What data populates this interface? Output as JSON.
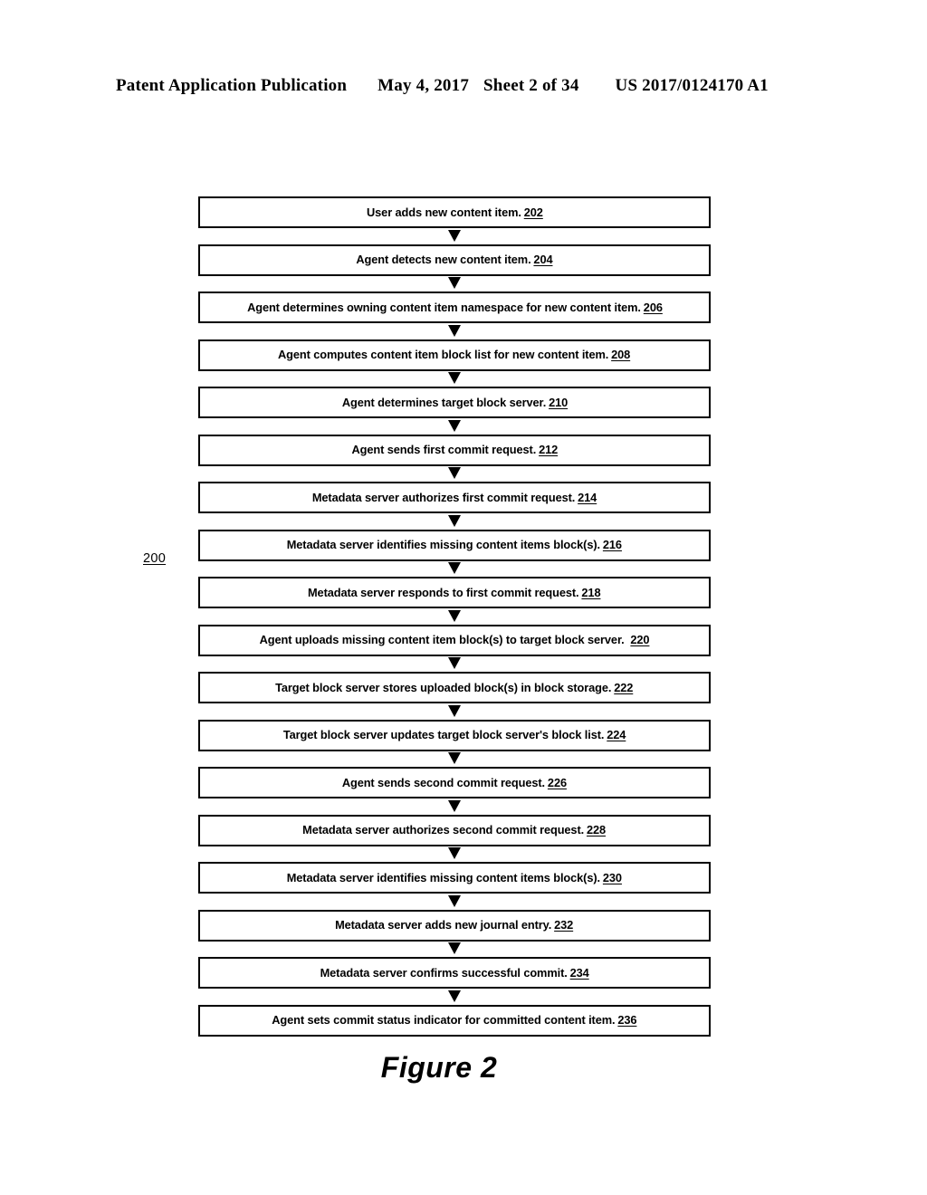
{
  "header": {
    "publication": "Patent Application Publication",
    "date": "May 4, 2017",
    "sheet": "Sheet 2 of 34",
    "document_number": "US 2017/0124170 A1"
  },
  "figure": {
    "caption": "Figure 2",
    "diagram_reference": "200"
  },
  "flowchart": {
    "type": "flowchart",
    "orientation": "top-to-bottom",
    "connector": "solid-down-arrow",
    "steps": [
      {
        "text": "User adds new content item.",
        "ref": "202"
      },
      {
        "text": "Agent detects new content item.",
        "ref": "204"
      },
      {
        "text": "Agent determines owning content item namespace for new content item.",
        "ref": "206"
      },
      {
        "text": "Agent computes content item block list for new content item.",
        "ref": "208"
      },
      {
        "text": "Agent determines target block server.",
        "ref": "210"
      },
      {
        "text": "Agent sends first commit request.",
        "ref": "212"
      },
      {
        "text": "Metadata server authorizes first commit request.",
        "ref": "214"
      },
      {
        "text": "Metadata server identifies missing content items block(s).",
        "ref": "216"
      },
      {
        "text": "Metadata server responds to first commit request.",
        "ref": "218"
      },
      {
        "text": "Agent uploads missing content item block(s) to target block server.",
        "ref": "220",
        "wide_gap": true
      },
      {
        "text": "Target block server stores uploaded block(s) in block storage.",
        "ref": "222"
      },
      {
        "text": "Target block server updates target block server's block list.",
        "ref": "224"
      },
      {
        "text": "Agent sends second commit request.",
        "ref": "226"
      },
      {
        "text": "Metadata server authorizes second commit request.",
        "ref": "228"
      },
      {
        "text": "Metadata server identifies missing content items block(s).",
        "ref": "230"
      },
      {
        "text": "Metadata server adds new journal entry.",
        "ref": "232"
      },
      {
        "text": "Metadata server confirms successful commit.",
        "ref": "234"
      },
      {
        "text": "Agent sets commit status indicator for committed content item.",
        "ref": "236"
      }
    ]
  },
  "colors": {
    "page_background": "#ffffff",
    "ink": "#000000"
  }
}
